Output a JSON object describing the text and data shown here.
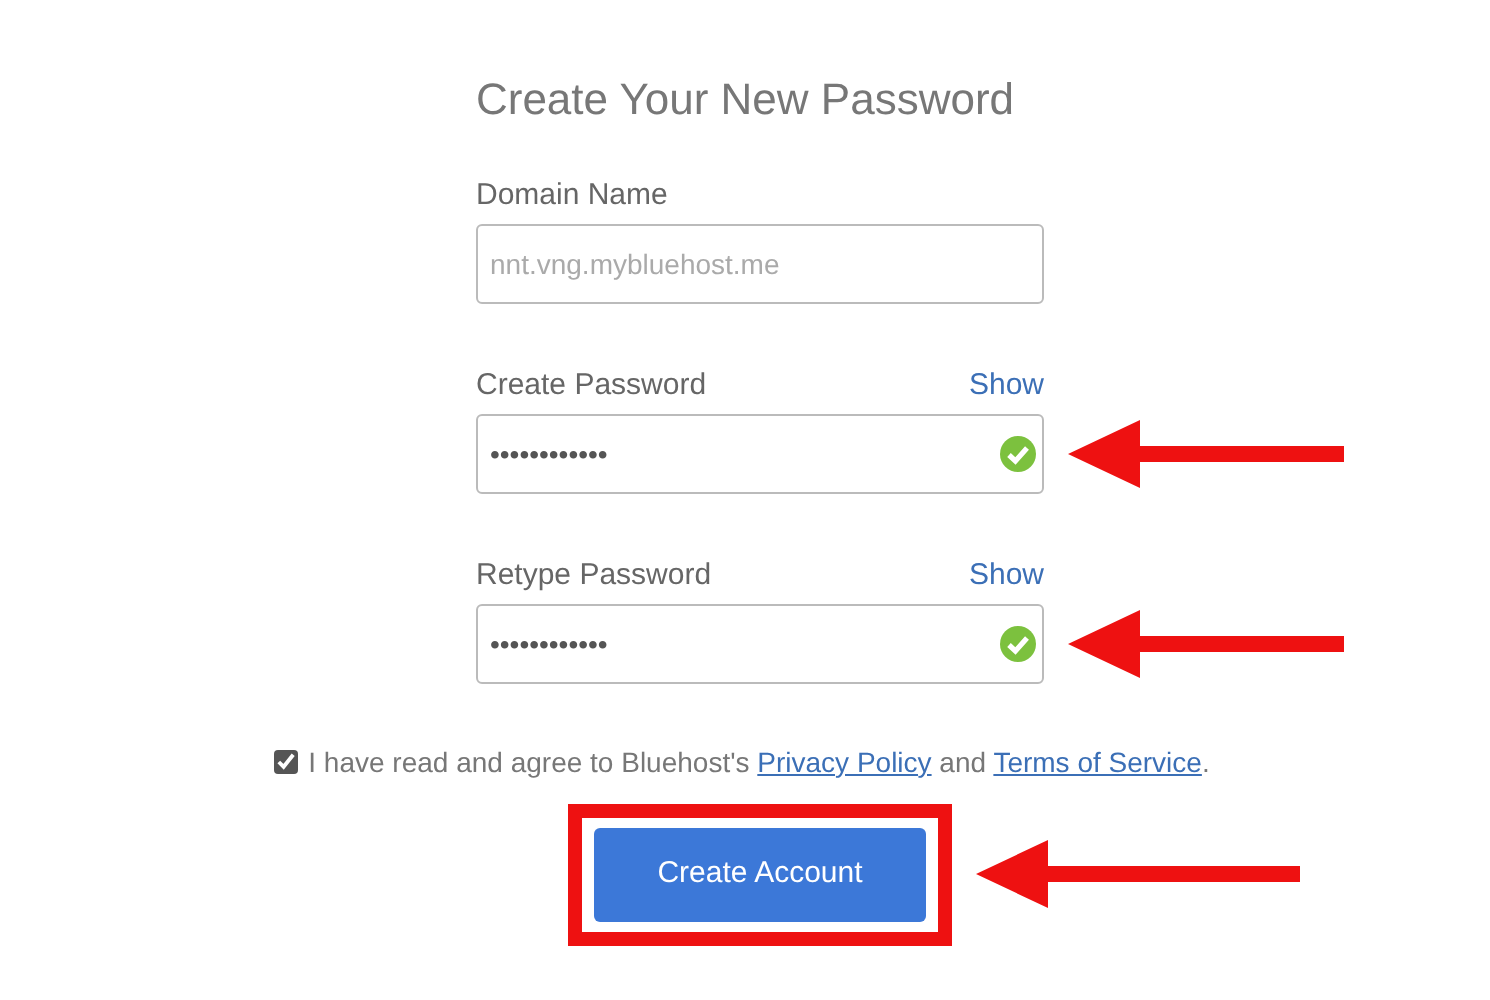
{
  "title": "Create Your New Password",
  "fields": [
    {
      "label": "Domain Name",
      "placeholder": "nnt.vng.mybluehost.me",
      "arrow": false
    },
    {
      "label": "Create Password",
      "show_link": "Show",
      "value": "••••••••••••",
      "valid": true,
      "arrow": true
    },
    {
      "label": "Retype Password",
      "show_link": "Show",
      "value": "••••••••••••",
      "valid": true,
      "arrow": true
    }
  ],
  "agreement": {
    "checked": true,
    "parts": [
      {
        "kind": "text",
        "text": "I have read and agree to Bluehost's "
      },
      {
        "kind": "link",
        "text": "Privacy Policy"
      },
      {
        "kind": "text",
        "text": " and "
      },
      {
        "kind": "link",
        "text": "Terms of Service"
      },
      {
        "kind": "text",
        "text": "."
      }
    ]
  },
  "button": {
    "label": "Create Account",
    "highlighted": true,
    "arrow": true
  }
}
